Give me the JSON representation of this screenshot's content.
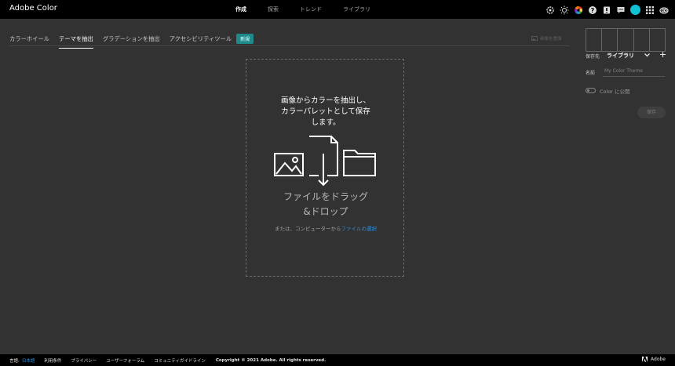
{
  "app": {
    "title": "Adobe Color"
  },
  "topnav": [
    "作成",
    "探索",
    "トレンド",
    "ライブラリ"
  ],
  "top_icons": [
    "settings-icon",
    "brightness-icon",
    "color-wheel-icon",
    "help-icon",
    "notification-icon",
    "chat-icon",
    "user-avatar",
    "apps-grid-icon",
    "creative-cloud-icon"
  ],
  "subtabs": {
    "items": [
      "カラーホイール",
      "テーマを抽出",
      "グラデーションを抽出",
      "アクセシビリティツール"
    ],
    "active": "テーマを抽出",
    "badge": "新規",
    "image_replace": "画像を置換"
  },
  "dropzone": {
    "heading_lines": [
      "画像からカラーを抽出し、",
      "カラーパレットとして保存",
      "します。"
    ],
    "drag_lines": [
      "ファイルをドラッグ",
      "&ドロップ"
    ],
    "or_text": "または、コンピューターから",
    "select_link": "ファイルの選択"
  },
  "panel": {
    "save_to_label": "保存先",
    "save_to_value": "ライブラリ",
    "name_label": "名前",
    "name_placeholder": "My Color Theme",
    "toggle_label": "Color に公開",
    "save_button": "保存"
  },
  "footer": {
    "language_label": "言語:",
    "language_value": "日本語",
    "links": [
      "利用条件",
      "プライバシー",
      "ユーザーフォーラム",
      "コミュニティガイドライン"
    ],
    "copyright": "Copyright © 2021 Adobe. All rights reserved.",
    "brand": "Adobe"
  },
  "colors": {
    "accent": "#1e8a8c",
    "link": "#2b8fe6",
    "avatar": "#10c1d4",
    "background": "#323232"
  }
}
